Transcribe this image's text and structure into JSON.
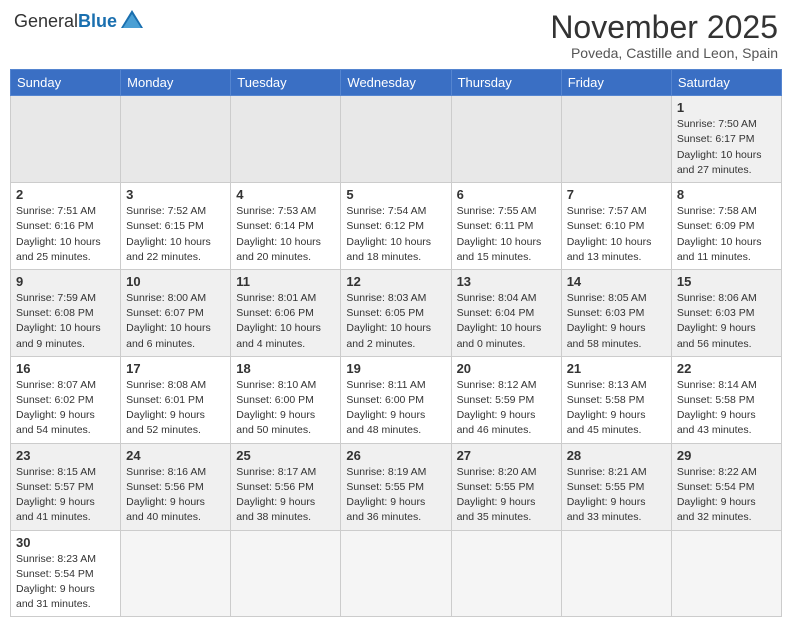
{
  "header": {
    "logo_general": "General",
    "logo_blue": "Blue",
    "month_title": "November 2025",
    "subtitle": "Poveda, Castille and Leon, Spain"
  },
  "weekdays": [
    "Sunday",
    "Monday",
    "Tuesday",
    "Wednesday",
    "Thursday",
    "Friday",
    "Saturday"
  ],
  "weeks": [
    [
      {
        "day": "",
        "info": "",
        "empty": true
      },
      {
        "day": "",
        "info": "",
        "empty": true
      },
      {
        "day": "",
        "info": "",
        "empty": true
      },
      {
        "day": "",
        "info": "",
        "empty": true
      },
      {
        "day": "",
        "info": "",
        "empty": true
      },
      {
        "day": "",
        "info": "",
        "empty": true
      },
      {
        "day": "1",
        "info": "Sunrise: 7:50 AM\nSunset: 6:17 PM\nDaylight: 10 hours and 27 minutes.",
        "empty": false
      }
    ],
    [
      {
        "day": "2",
        "info": "Sunrise: 7:51 AM\nSunset: 6:16 PM\nDaylight: 10 hours and 25 minutes.",
        "empty": false
      },
      {
        "day": "3",
        "info": "Sunrise: 7:52 AM\nSunset: 6:15 PM\nDaylight: 10 hours and 22 minutes.",
        "empty": false
      },
      {
        "day": "4",
        "info": "Sunrise: 7:53 AM\nSunset: 6:14 PM\nDaylight: 10 hours and 20 minutes.",
        "empty": false
      },
      {
        "day": "5",
        "info": "Sunrise: 7:54 AM\nSunset: 6:12 PM\nDaylight: 10 hours and 18 minutes.",
        "empty": false
      },
      {
        "day": "6",
        "info": "Sunrise: 7:55 AM\nSunset: 6:11 PM\nDaylight: 10 hours and 15 minutes.",
        "empty": false
      },
      {
        "day": "7",
        "info": "Sunrise: 7:57 AM\nSunset: 6:10 PM\nDaylight: 10 hours and 13 minutes.",
        "empty": false
      },
      {
        "day": "8",
        "info": "Sunrise: 7:58 AM\nSunset: 6:09 PM\nDaylight: 10 hours and 11 minutes.",
        "empty": false
      }
    ],
    [
      {
        "day": "9",
        "info": "Sunrise: 7:59 AM\nSunset: 6:08 PM\nDaylight: 10 hours and 9 minutes.",
        "empty": false
      },
      {
        "day": "10",
        "info": "Sunrise: 8:00 AM\nSunset: 6:07 PM\nDaylight: 10 hours and 6 minutes.",
        "empty": false
      },
      {
        "day": "11",
        "info": "Sunrise: 8:01 AM\nSunset: 6:06 PM\nDaylight: 10 hours and 4 minutes.",
        "empty": false
      },
      {
        "day": "12",
        "info": "Sunrise: 8:03 AM\nSunset: 6:05 PM\nDaylight: 10 hours and 2 minutes.",
        "empty": false
      },
      {
        "day": "13",
        "info": "Sunrise: 8:04 AM\nSunset: 6:04 PM\nDaylight: 10 hours and 0 minutes.",
        "empty": false
      },
      {
        "day": "14",
        "info": "Sunrise: 8:05 AM\nSunset: 6:03 PM\nDaylight: 9 hours and 58 minutes.",
        "empty": false
      },
      {
        "day": "15",
        "info": "Sunrise: 8:06 AM\nSunset: 6:03 PM\nDaylight: 9 hours and 56 minutes.",
        "empty": false
      }
    ],
    [
      {
        "day": "16",
        "info": "Sunrise: 8:07 AM\nSunset: 6:02 PM\nDaylight: 9 hours and 54 minutes.",
        "empty": false
      },
      {
        "day": "17",
        "info": "Sunrise: 8:08 AM\nSunset: 6:01 PM\nDaylight: 9 hours and 52 minutes.",
        "empty": false
      },
      {
        "day": "18",
        "info": "Sunrise: 8:10 AM\nSunset: 6:00 PM\nDaylight: 9 hours and 50 minutes.",
        "empty": false
      },
      {
        "day": "19",
        "info": "Sunrise: 8:11 AM\nSunset: 6:00 PM\nDaylight: 9 hours and 48 minutes.",
        "empty": false
      },
      {
        "day": "20",
        "info": "Sunrise: 8:12 AM\nSunset: 5:59 PM\nDaylight: 9 hours and 46 minutes.",
        "empty": false
      },
      {
        "day": "21",
        "info": "Sunrise: 8:13 AM\nSunset: 5:58 PM\nDaylight: 9 hours and 45 minutes.",
        "empty": false
      },
      {
        "day": "22",
        "info": "Sunrise: 8:14 AM\nSunset: 5:58 PM\nDaylight: 9 hours and 43 minutes.",
        "empty": false
      }
    ],
    [
      {
        "day": "23",
        "info": "Sunrise: 8:15 AM\nSunset: 5:57 PM\nDaylight: 9 hours and 41 minutes.",
        "empty": false
      },
      {
        "day": "24",
        "info": "Sunrise: 8:16 AM\nSunset: 5:56 PM\nDaylight: 9 hours and 40 minutes.",
        "empty": false
      },
      {
        "day": "25",
        "info": "Sunrise: 8:17 AM\nSunset: 5:56 PM\nDaylight: 9 hours and 38 minutes.",
        "empty": false
      },
      {
        "day": "26",
        "info": "Sunrise: 8:19 AM\nSunset: 5:55 PM\nDaylight: 9 hours and 36 minutes.",
        "empty": false
      },
      {
        "day": "27",
        "info": "Sunrise: 8:20 AM\nSunset: 5:55 PM\nDaylight: 9 hours and 35 minutes.",
        "empty": false
      },
      {
        "day": "28",
        "info": "Sunrise: 8:21 AM\nSunset: 5:55 PM\nDaylight: 9 hours and 33 minutes.",
        "empty": false
      },
      {
        "day": "29",
        "info": "Sunrise: 8:22 AM\nSunset: 5:54 PM\nDaylight: 9 hours and 32 minutes.",
        "empty": false
      }
    ],
    [
      {
        "day": "30",
        "info": "Sunrise: 8:23 AM\nSunset: 5:54 PM\nDaylight: 9 hours and 31 minutes.",
        "empty": false
      },
      {
        "day": "",
        "info": "",
        "empty": true
      },
      {
        "day": "",
        "info": "",
        "empty": true
      },
      {
        "day": "",
        "info": "",
        "empty": true
      },
      {
        "day": "",
        "info": "",
        "empty": true
      },
      {
        "day": "",
        "info": "",
        "empty": true
      },
      {
        "day": "",
        "info": "",
        "empty": true
      }
    ]
  ]
}
